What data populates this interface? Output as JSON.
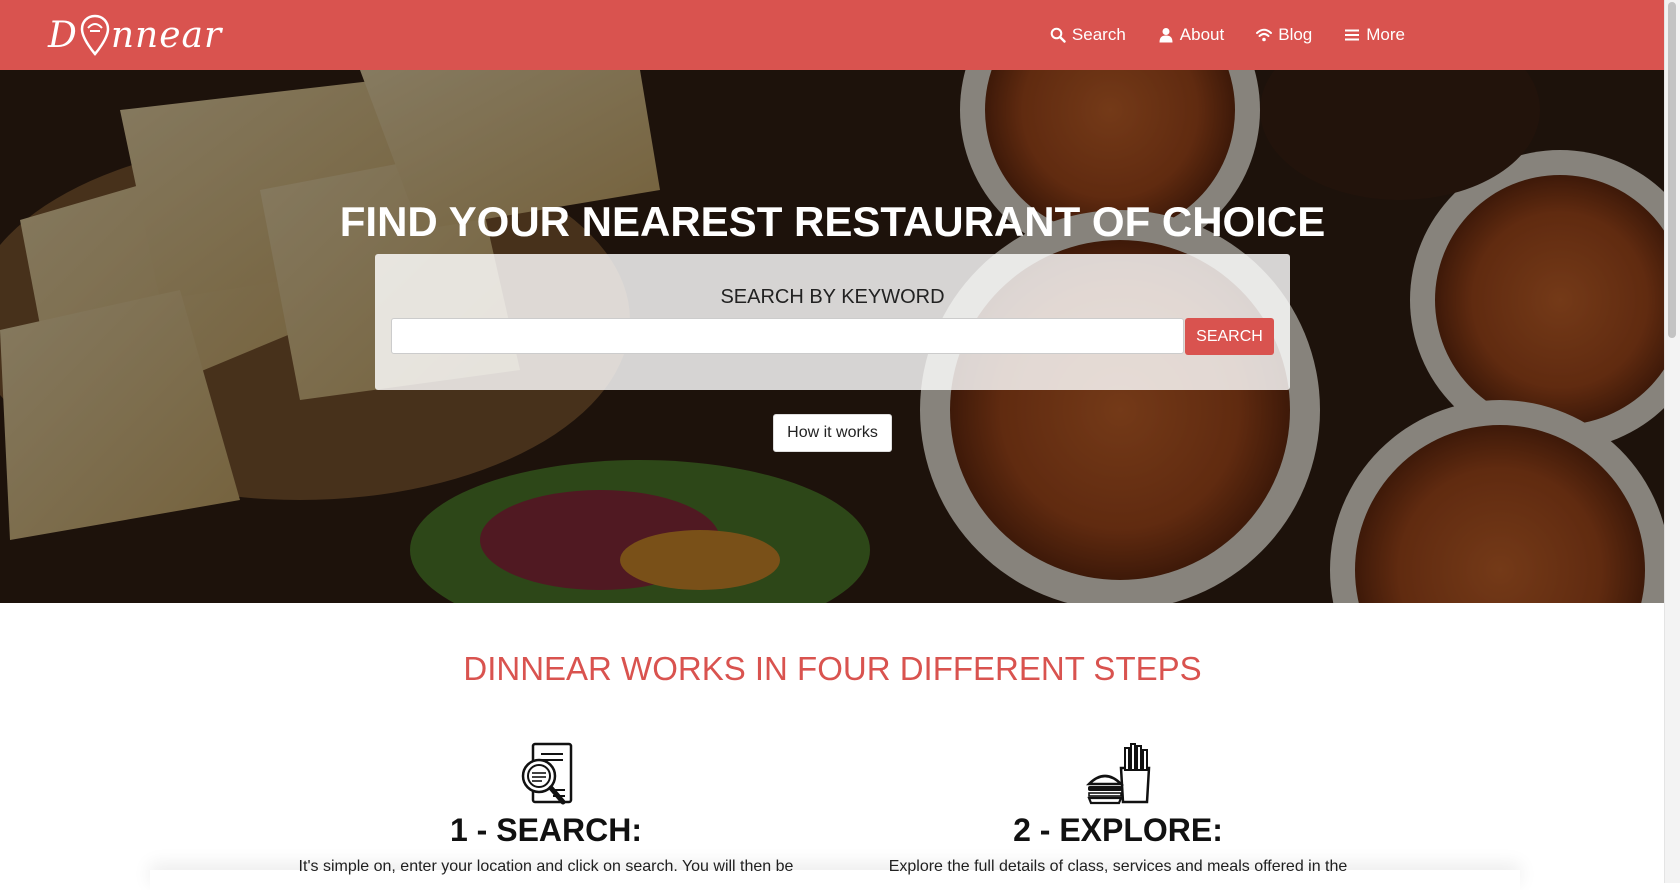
{
  "nav": {
    "brand": "Dinnear",
    "items": [
      {
        "label": "Search",
        "icon": "search-icon"
      },
      {
        "label": "About",
        "icon": "user-icon"
      },
      {
        "label": "Blog",
        "icon": "wifi-icon"
      },
      {
        "label": "More",
        "icon": "menu-icon"
      }
    ]
  },
  "hero": {
    "title": "FIND YOUR NEAREST RESTAURANT OF CHOICE",
    "search_heading": "SEARCH BY KEYWORD",
    "search_value": "",
    "search_button": "SEARCH",
    "how_button": "How it works"
  },
  "steps": {
    "title": "DINNEAR WORKS IN FOUR DIFFERENT STEPS",
    "items": [
      {
        "title": "1 - SEARCH:",
        "desc": "It's simple on, enter your location and click on search. You will then be",
        "icon": "search-document-icon"
      },
      {
        "title": "2 - EXPLORE:",
        "desc": "Explore the full details of class, services and meals offered in the",
        "icon": "burger-fries-icon"
      }
    ]
  },
  "colors": {
    "accent": "#d9534f",
    "nav_text": "#ffffff",
    "text": "#222222"
  }
}
